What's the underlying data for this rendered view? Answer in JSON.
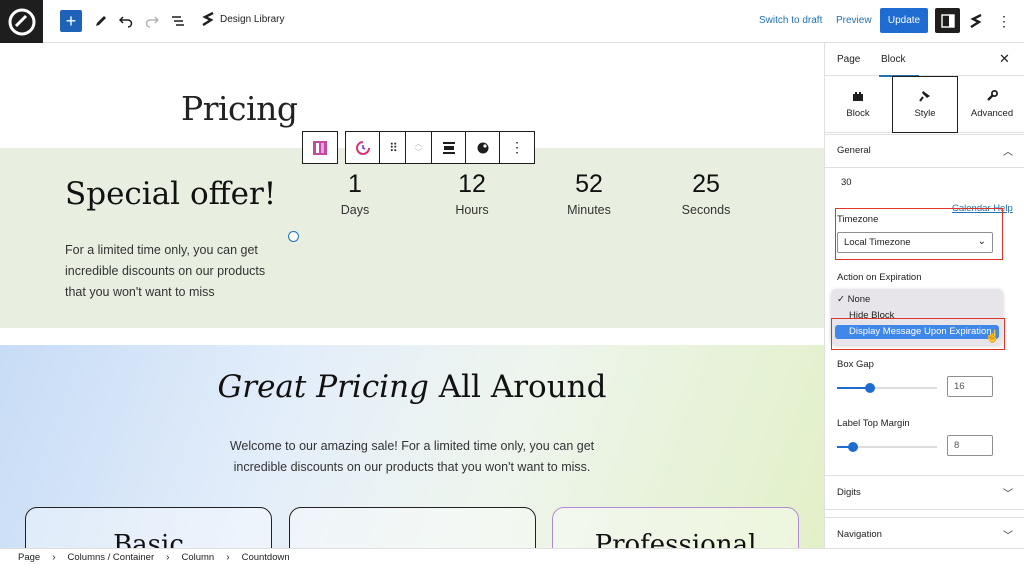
{
  "toolbar": {
    "add_icon": "plus-icon",
    "document_title": "Design Library",
    "switch_to_draft": "Switch to draft",
    "preview": "Preview",
    "update": "Update",
    "colors": {
      "accent": "#1e6cd1",
      "link": "#2271b1"
    }
  },
  "canvas": {
    "page_heading": "Pricing",
    "offer": {
      "title": "Special offer!",
      "text": "For a limited time only, you can get incredible discounts on our products that you won't want to miss",
      "countdown": [
        {
          "value": "1",
          "label": "Days"
        },
        {
          "value": "12",
          "label": "Hours"
        },
        {
          "value": "52",
          "label": "Minutes"
        },
        {
          "value": "25",
          "label": "Seconds"
        }
      ]
    },
    "pricing": {
      "title_italic": "Great Pricing",
      "title_rest": " All Around",
      "text_line1": "Welcome to our amazing sale! For a limited time only, you can get",
      "text_line2": "incredible discounts on our products that you won't want to miss.",
      "cards": [
        {
          "title": "Basic"
        },
        {
          "title": ""
        },
        {
          "title": "Professional"
        }
      ]
    }
  },
  "sidebar": {
    "tabs": [
      "Page",
      "Block"
    ],
    "active_tab": "Block",
    "sub_tabs": [
      "Block",
      "Style",
      "Advanced"
    ],
    "active_sub_tab": "Style",
    "general": {
      "label": "General",
      "value_30": "30",
      "calendar_help": "Calendar Help",
      "timezone_label": "Timezone",
      "timezone_value": "Local Timezone",
      "action_label": "Action on Expiration",
      "options": [
        "None",
        "Hide Block",
        "Display Message Upon Expiration"
      ],
      "selected_option": "None",
      "highlighted_option": "Display Message Upon Expiration",
      "box_gap_label": "Box Gap",
      "box_gap_value": 16,
      "label_margin_label": "Label Top Margin",
      "label_margin_value": 8
    },
    "panels": [
      "Digits",
      "Navigation"
    ]
  },
  "breadcrumb": [
    "Page",
    "Columns / Container",
    "Column",
    "Countdown"
  ]
}
